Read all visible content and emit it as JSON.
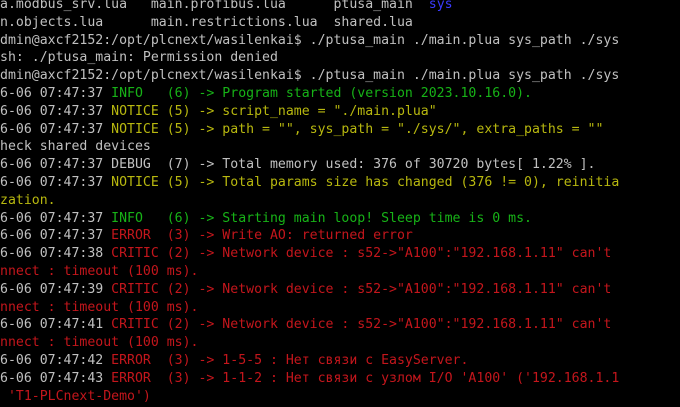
{
  "colors": {
    "background": "#000000",
    "default": "#c0c0c0",
    "info": "#17b317",
    "notice": "#b8b80f",
    "error": "#c4161c",
    "debug": "#c0c0c0",
    "sys_dir": "#3b3bff"
  },
  "lines": [
    [
      {
        "text": "a.modbus_srv.lua   main.profibus.lua      ptusa_main  ",
        "color": "default"
      },
      {
        "text": "sys",
        "color": "sys_dir"
      }
    ],
    [
      {
        "text": "n.objects.lua      main.restrictions.lua  shared.lua",
        "color": "default"
      }
    ],
    [
      {
        "text": "dmin@axcf2152:/opt/plcnext/wasilenkai$ ./ptusa_main ./main.plua sys_path ./sys",
        "color": "default"
      }
    ],
    [
      {
        "text": "sh: ./ptusa_main: Permission denied",
        "color": "default"
      }
    ],
    [
      {
        "text": "dmin@axcf2152:/opt/plcnext/wasilenkai$ ./ptusa_main ./main.plua sys_path ./sys",
        "color": "default"
      }
    ],
    [
      {
        "text": "6-06 07:47:37 ",
        "color": "default"
      },
      {
        "text": "INFO   (6) -> Program started (version 2023.10.16.0).",
        "color": "info"
      }
    ],
    [
      {
        "text": "6-06 07:47:37 ",
        "color": "default"
      },
      {
        "text": "NOTICE (5) -> script_name = \"./main.plua\"",
        "color": "notice"
      }
    ],
    [
      {
        "text": "6-06 07:47:37 ",
        "color": "default"
      },
      {
        "text": "NOTICE (5) -> path = \"\", sys_path = \"./sys/\", extra_paths = \"\"",
        "color": "notice"
      }
    ],
    [
      {
        "text": "heck shared devices",
        "color": "default"
      }
    ],
    [
      {
        "text": "6-06 07:47:37 DEBUG  (7) -> Total memory used: 376 of 30720 bytes[ 1.22% ].",
        "color": "debug"
      }
    ],
    [
      {
        "text": "6-06 07:47:37 ",
        "color": "default"
      },
      {
        "text": "NOTICE (5) -> Total params size has changed (376 != 0), reinitia",
        "color": "notice"
      }
    ],
    [
      {
        "text": "zation.",
        "color": "notice"
      }
    ],
    [
      {
        "text": "6-06 07:47:37 ",
        "color": "default"
      },
      {
        "text": "INFO   (6) -> Starting main loop! Sleep time is 0 ms.",
        "color": "info"
      }
    ],
    [
      {
        "text": "6-06 07:47:37 ",
        "color": "default"
      },
      {
        "text": "ERROR  (3) -> Write AO: returned error",
        "color": "error"
      }
    ],
    [
      {
        "text": "6-06 07:47:38 ",
        "color": "default"
      },
      {
        "text": "CRITIC (2) -> Network device : s52->\"A100\":\"192.168.1.11\" can't",
        "color": "error"
      }
    ],
    [
      {
        "text": "nnect : timeout (100 ms).",
        "color": "error"
      }
    ],
    [
      {
        "text": "6-06 07:47:39 ",
        "color": "default"
      },
      {
        "text": "CRITIC (2) -> Network device : s52->\"A100\":\"192.168.1.11\" can't",
        "color": "error"
      }
    ],
    [
      {
        "text": "nnect : timeout (100 ms).",
        "color": "error"
      }
    ],
    [
      {
        "text": "6-06 07:47:41 ",
        "color": "default"
      },
      {
        "text": "CRITIC (2) -> Network device : s52->\"A100\":\"192.168.1.11\" can't",
        "color": "error"
      }
    ],
    [
      {
        "text": "nnect : timeout (100 ms).",
        "color": "error"
      }
    ],
    [
      {
        "text": "6-06 07:47:42 ",
        "color": "default"
      },
      {
        "text": "ERROR  (3) -> 1-5-5 : Нет связи с EasyServer.",
        "color": "error"
      }
    ],
    [
      {
        "text": "6-06 07:47:43 ",
        "color": "default"
      },
      {
        "text": "ERROR  (3) -> 1-1-2 : Нет связи с узлом I/O 'A100' ('192.168.1.1",
        "color": "error"
      }
    ],
    [
      {
        "text": " 'T1-PLCnext-Demo')",
        "color": "error"
      }
    ]
  ]
}
